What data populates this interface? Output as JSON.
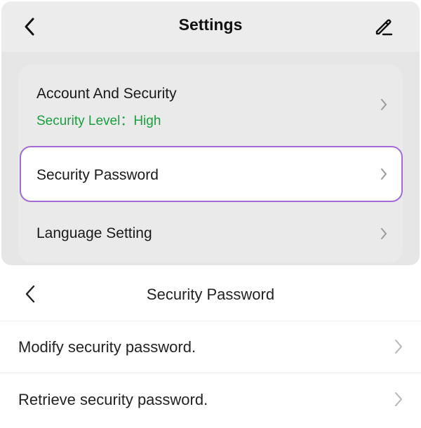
{
  "settings_screen": {
    "title": "Settings",
    "back_icon": "chevron-left-icon",
    "edit_icon": "pencil-icon",
    "items": [
      {
        "label": "Account And Security",
        "sub_label": "Security Level：High"
      },
      {
        "label": "Security Password"
      },
      {
        "label": "Language Setting"
      }
    ]
  },
  "security_password_screen": {
    "title": "Security Password",
    "back_icon": "chevron-left-icon",
    "items": [
      {
        "label": "Modify security password."
      },
      {
        "label": "Retrieve security password."
      }
    ]
  },
  "colors": {
    "accent_green": "#1a9e3e",
    "highlight_border": "#a46ad8"
  }
}
